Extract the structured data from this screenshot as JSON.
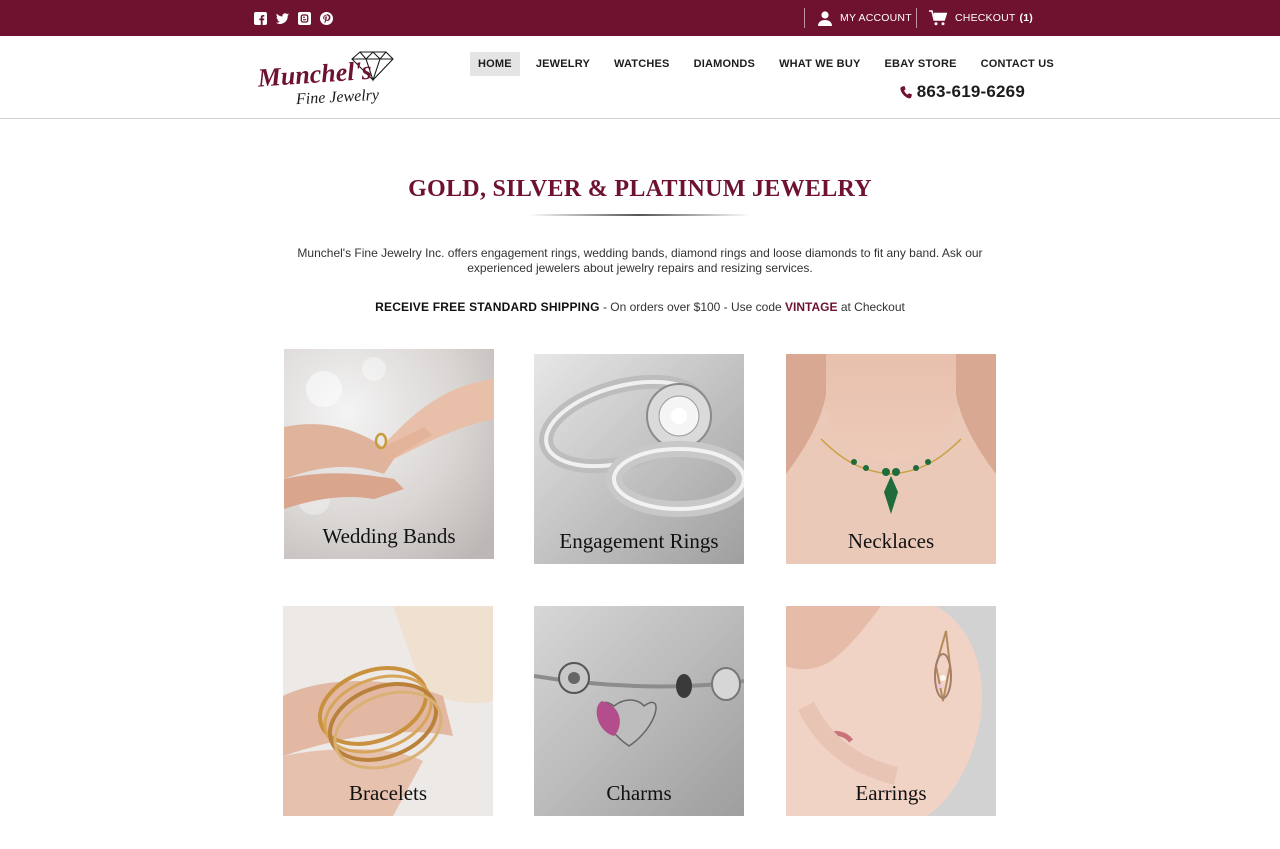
{
  "topbar": {
    "social": [
      "facebook-icon",
      "twitter-icon",
      "blogger-icon",
      "pinterest-icon"
    ],
    "account_label": "MY ACCOUNT",
    "checkout_label": "CHECKOUT",
    "checkout_count": "(1)"
  },
  "header": {
    "logo_line1": "Munchel's",
    "logo_line2": "Fine Jewelry",
    "nav": [
      "HOME",
      "JEWELRY",
      "WATCHES",
      "DIAMONDS",
      "WHAT WE BUY",
      "EBAY STORE",
      "CONTACT US"
    ],
    "active_nav": "HOME",
    "phone": "863-619-6269"
  },
  "main": {
    "title": "GOLD, SILVER & PLATINUM JEWELRY",
    "intro": "Munchel's Fine Jewelry Inc. offers engagement rings, wedding bands, diamond rings and loose diamonds to fit any band. Ask our experienced jewelers about jewelry repairs and resizing services.",
    "shipping_strong": "RECEIVE FREE STANDARD SHIPPING",
    "shipping_mid": " - On orders over $100 - Use code ",
    "shipping_code": "VINTAGE",
    "shipping_end": " at Checkout"
  },
  "categories": [
    {
      "label": "Wedding Bands"
    },
    {
      "label": "Engagement Rings"
    },
    {
      "label": "Necklaces"
    },
    {
      "label": "Bracelets"
    },
    {
      "label": "Charms"
    },
    {
      "label": "Earrings"
    }
  ],
  "colors": {
    "brand": "#6e1230",
    "nav_active_bg": "#e4e4e4"
  }
}
